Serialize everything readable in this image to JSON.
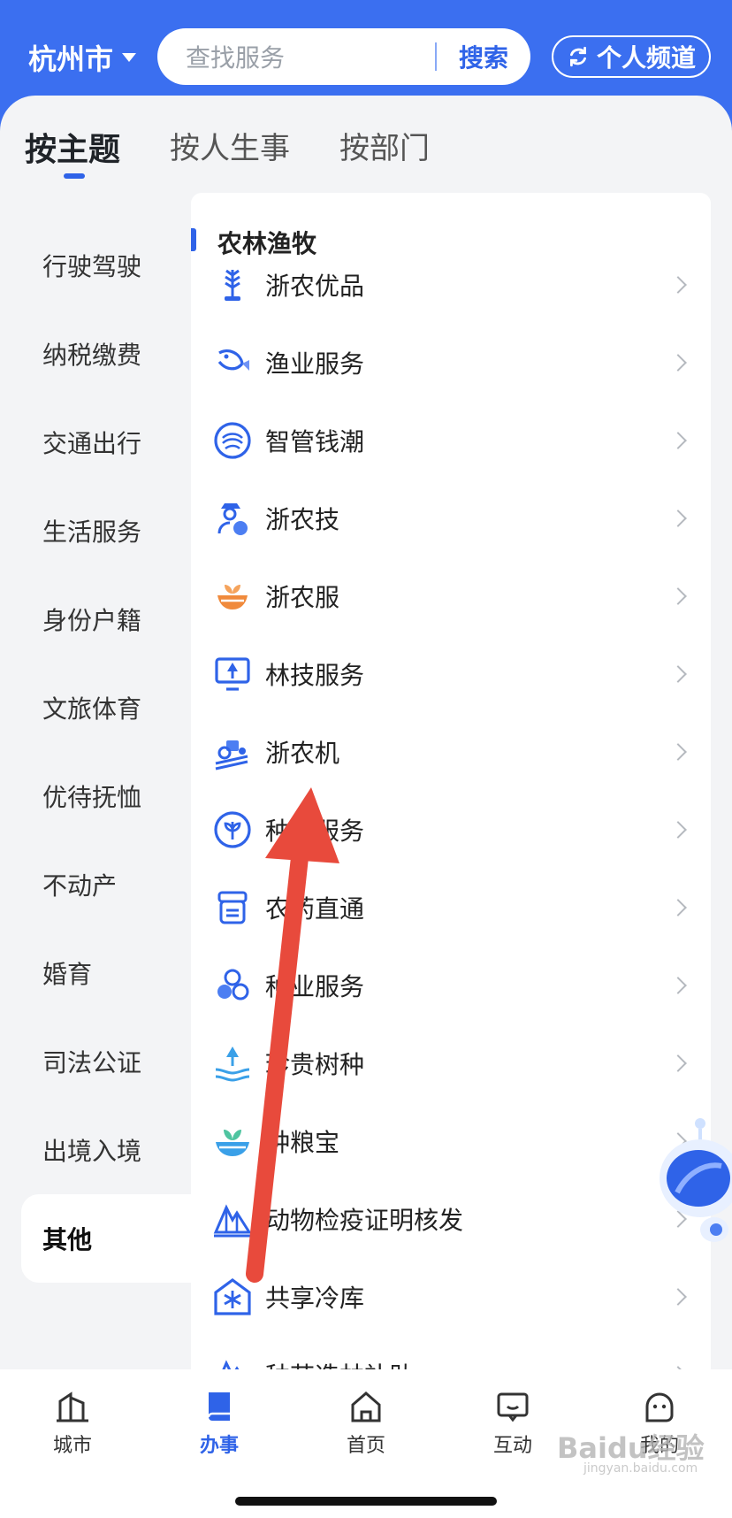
{
  "header": {
    "city": "杭州市",
    "search_placeholder": "查找服务",
    "search_button": "搜索",
    "channel_button": "个人频道"
  },
  "tabs": [
    {
      "label": "按主题",
      "active": true
    },
    {
      "label": "按人生事",
      "active": false
    },
    {
      "label": "按部门",
      "active": false
    }
  ],
  "sidebar": [
    {
      "label": "行驶驾驶"
    },
    {
      "label": "纳税缴费"
    },
    {
      "label": "交通出行"
    },
    {
      "label": "生活服务"
    },
    {
      "label": "身份户籍"
    },
    {
      "label": "文旅体育"
    },
    {
      "label": "优待抚恤"
    },
    {
      "label": "不动产"
    },
    {
      "label": "婚育"
    },
    {
      "label": "司法公证"
    },
    {
      "label": "出境入境"
    },
    {
      "label": "其他",
      "active": true
    }
  ],
  "section": {
    "title": "农林渔牧",
    "items": [
      {
        "label": "浙农优品",
        "icon": "wheat-icon"
      },
      {
        "label": "渔业服务",
        "icon": "fish-icon"
      },
      {
        "label": "智管钱潮",
        "icon": "wave-icon"
      },
      {
        "label": "浙农技",
        "icon": "farmer-icon"
      },
      {
        "label": "浙农服",
        "icon": "bowl-sprout-icon"
      },
      {
        "label": "林技服务",
        "icon": "tree-screen-icon"
      },
      {
        "label": "浙农机",
        "icon": "tractor-icon"
      },
      {
        "label": "种子服务",
        "icon": "leaf-circle-icon"
      },
      {
        "label": "农药直通",
        "icon": "pesticide-icon"
      },
      {
        "label": "种业服务",
        "icon": "seed-cluster-icon"
      },
      {
        "label": "珍贵树种",
        "icon": "hand-tree-icon"
      },
      {
        "label": "种粮宝",
        "icon": "grain-bowl-icon"
      },
      {
        "label": "动物检疫证明核发",
        "icon": "mountain-icon"
      },
      {
        "label": "共享冷库",
        "icon": "snowflake-house-icon"
      },
      {
        "label": "种苗造林补助",
        "icon": "mountain-icon"
      }
    ]
  },
  "bottom_nav": [
    {
      "label": "城市",
      "icon": "city-icon"
    },
    {
      "label": "办事",
      "icon": "book-icon",
      "active": true
    },
    {
      "label": "首页",
      "icon": "home-icon"
    },
    {
      "label": "互动",
      "icon": "chat-icon"
    },
    {
      "label": "我的",
      "icon": "face-icon"
    }
  ],
  "watermark": {
    "text": "Baidu经验",
    "sub": "jingyan.baidu.com"
  },
  "colors": {
    "primary": "#3b6ff0",
    "accent": "#2f63e8",
    "arrow": "#e84a3c"
  }
}
